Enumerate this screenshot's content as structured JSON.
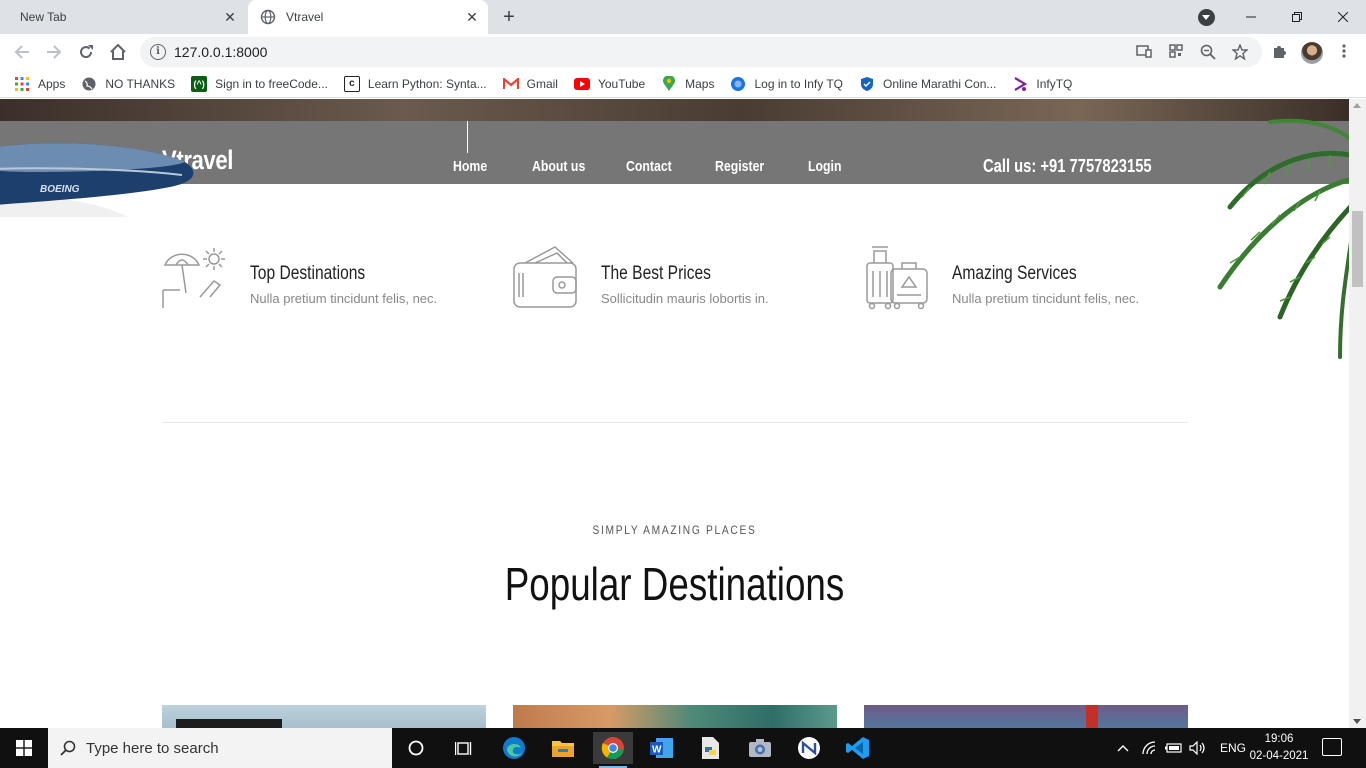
{
  "browser": {
    "tabs": [
      {
        "title": "New Tab",
        "active": false
      },
      {
        "title": "Vtravel",
        "active": true
      }
    ],
    "new_tab_symbol": "+",
    "close_symbol": "✕",
    "url": "127.0.0.1:8000",
    "bookmarks": [
      {
        "label": "Apps",
        "icon": "apps-grid-icon"
      },
      {
        "label": "NO THANKS",
        "icon": "globe-icon"
      },
      {
        "label": "Sign in to freeCode...",
        "icon": "freecodecamp-icon"
      },
      {
        "label": "Learn Python: Synta...",
        "icon": "codecademy-icon"
      },
      {
        "label": "Gmail",
        "icon": "gmail-icon"
      },
      {
        "label": "YouTube",
        "icon": "youtube-icon"
      },
      {
        "label": "Maps",
        "icon": "maps-pin-icon"
      },
      {
        "label": "Log in to Infy TQ",
        "icon": "infytq-icon"
      },
      {
        "label": "Online Marathi Con...",
        "icon": "shield-icon"
      },
      {
        "label": "InfyTQ",
        "icon": "infytq-logo-icon"
      }
    ]
  },
  "site": {
    "brand": "Vtravel",
    "nav": [
      "Home",
      "About us",
      "Contact",
      "Register",
      "Login"
    ],
    "call_us": "Call us: +91 7757823155",
    "features": [
      {
        "title": "Top Destinations",
        "subtitle": "Nulla pretium tincidunt felis, nec.",
        "icon": "beach-umbrella-icon"
      },
      {
        "title": "The Best Prices",
        "subtitle": "Sollicitudin mauris lobortis in.",
        "icon": "wallet-icon"
      },
      {
        "title": "Amazing Services",
        "subtitle": "Nulla pretium tincidunt felis, nec.",
        "icon": "luggage-icon"
      }
    ],
    "eyebrow": "SIMPLY AMAZING PLACES",
    "section_title": "Popular Destinations",
    "plane_text": "BOEING"
  },
  "taskbar": {
    "search_placeholder": "Type here to search",
    "language": "ENG",
    "time": "19:06",
    "date": "02-04-2021"
  },
  "colors": {
    "header_bg": "#767676",
    "tabstrip_bg": "#dee1e6",
    "taskbar_bg": "#101010"
  }
}
